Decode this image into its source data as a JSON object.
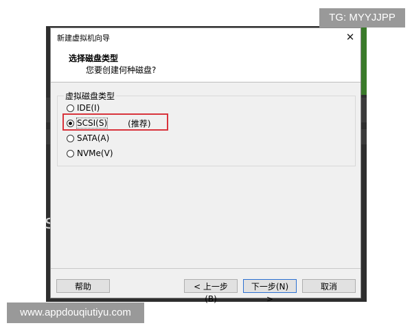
{
  "window": {
    "title": "新建虚拟机向导",
    "close_glyph": "✕"
  },
  "header": {
    "title": "选择磁盘类型",
    "subtitle": "您要创建何种磁盘?"
  },
  "disk_type_group": {
    "legend": "虚拟磁盘类型",
    "options": [
      {
        "label": "IDE(I)",
        "checked": false
      },
      {
        "label": "SCSI(S)",
        "checked": true,
        "note": "(推荐)"
      },
      {
        "label": "SATA(A)",
        "checked": false
      },
      {
        "label": "NVMe(V)",
        "checked": false
      }
    ]
  },
  "buttons": {
    "help": "帮助",
    "back": "< 上一步(B)",
    "next": "下一步(N) >",
    "cancel": "取消"
  },
  "watermarks": {
    "top": "TG: MYYJJPP",
    "bottom": "www.appdouqiutiyu.com"
  },
  "background": {
    "partial_text": "s"
  },
  "colors": {
    "highlight": "#d8323a",
    "default_button_border": "#2a6fd1",
    "dialog_bg": "#f0f0f0"
  }
}
